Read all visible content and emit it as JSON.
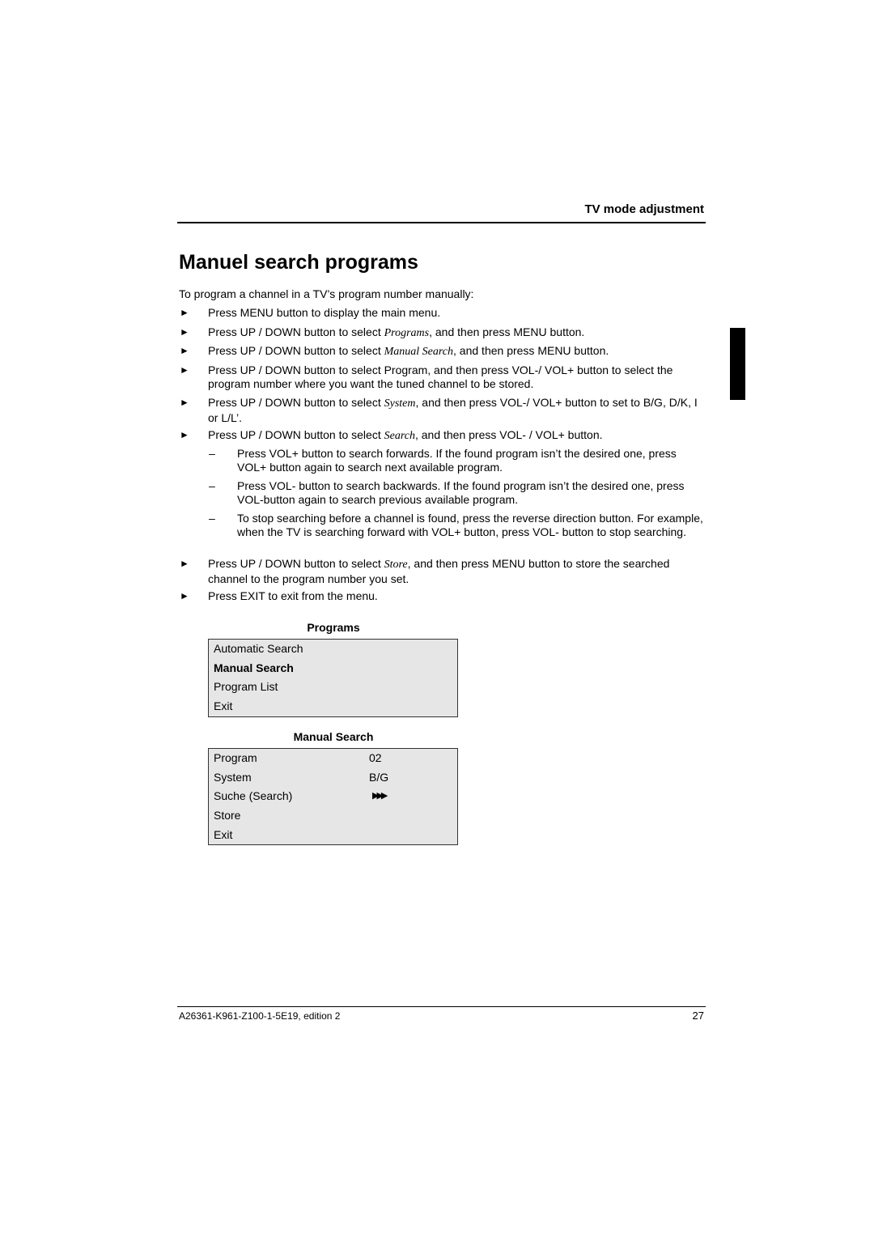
{
  "header": {
    "section": "TV mode adjustment"
  },
  "title": "Manuel search programs",
  "intro": "To program a channel in a TV’s program number manually:",
  "bullet_icon": "right-triangle",
  "steps": [
    {
      "pre": "Press MENU button to display the main menu.",
      "it": "",
      "post": ""
    },
    {
      "pre": "Press UP / DOWN button to select ",
      "it": "Programs",
      "post": ", and then press MENU button."
    },
    {
      "pre": "Press UP / DOWN button to select ",
      "it": "Manual Search",
      "post": ", and then press MENU button."
    },
    {
      "pre": "Press UP / DOWN button to select Program, and then press VOL-/ VOL+ button to select the program number where you want the tuned channel to be stored.",
      "it": "",
      "post": ""
    },
    {
      "pre": "Press UP / DOWN button to select ",
      "it": "System",
      "post": ", and then press VOL-/ VOL+ button to set to B/G, D/K, I or L/L’."
    },
    {
      "pre": "Press UP / DOWN button to select ",
      "it": "Search",
      "post": ", and then press VOL- / VOL+ button."
    },
    {
      "pre": "Press UP / DOWN button to select ",
      "it": "Store",
      "post": ", and then press MENU button to store the searched channel to the program number you set."
    },
    {
      "pre": "Press EXIT to exit from the menu.",
      "it": "",
      "post": ""
    }
  ],
  "substeps": [
    {
      "mark": "–",
      "text": "Press VOL+ button to search forwards. If the found program isn’t the desired one, press VOL+ button again to search next available program."
    },
    {
      "mark": "–",
      "text": "Press VOL- button to search backwards. If the found program isn’t the desired one, press VOL-button again to search previous available program."
    },
    {
      "mark": "–",
      "text": "To stop searching before a channel is found, press the reverse direction button. For example, when the TV is searching forward with VOL+ button, press VOL- button to stop searching."
    }
  ],
  "programs_menu": {
    "title": "Programs",
    "items": [
      "Automatic Search",
      "Manual Search",
      "Program List",
      "Exit"
    ],
    "selected": "Manual Search"
  },
  "manual_menu": {
    "title": "Manual Search",
    "rows": [
      {
        "label": "Program",
        "value": "02"
      },
      {
        "label": "System",
        "value": "B/G"
      },
      {
        "label": "Suche (Search)",
        "value": "▶▶▶"
      },
      {
        "label": "Store",
        "value": ""
      },
      {
        "label": "Exit",
        "value": ""
      }
    ]
  },
  "footer": {
    "doc_id": "A26361-K961-Z100-1-5E19, edition 2",
    "page": "27"
  }
}
